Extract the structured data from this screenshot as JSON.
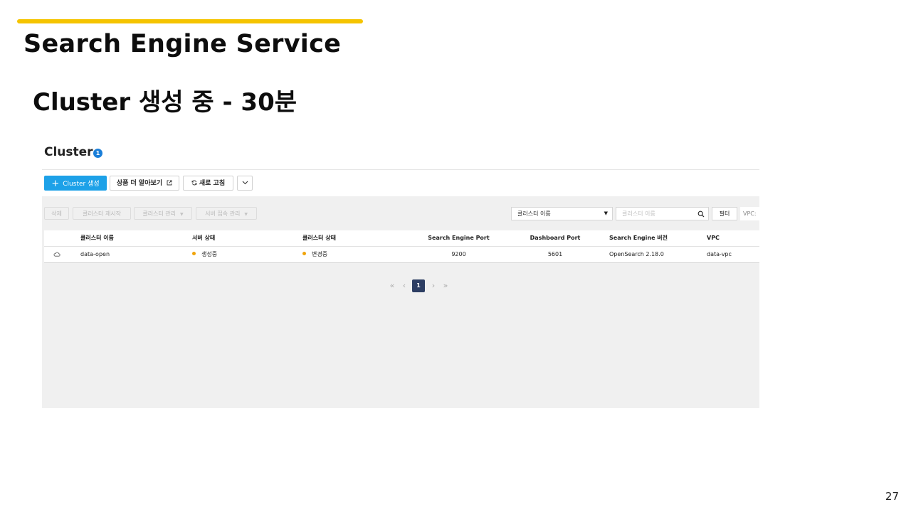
{
  "slide": {
    "title": "Search Engine Service",
    "subtitle": "Cluster 생성 중 - 30분",
    "page_number": "27",
    "accent_color": "#f5c400"
  },
  "console": {
    "header": {
      "title": "Cluster",
      "count": "1"
    },
    "actions": {
      "create_label": "Cluster 생성",
      "learn_more_label": "상품 더 알아보기",
      "refresh_label": "새로 고침"
    },
    "toolbar": {
      "delete_label": "삭제",
      "restart_label": "클러스터 재시작",
      "manage_label": "클러스터 관리",
      "access_label": "서버 접속 관리"
    },
    "filter": {
      "select_value": "클러스터 이름",
      "search_placeholder": "클러스터 이름",
      "filter_label": "필터",
      "vpc_label": "VPC:"
    },
    "table": {
      "columns": [
        "클러스터 이름",
        "서버 상태",
        "클러스터 상태",
        "Search Engine Port",
        "Dashboard Port",
        "Search Engine 버전",
        "VPC"
      ],
      "rows": [
        {
          "name": "data-open",
          "server_status": "생성중",
          "cluster_status": "변경중",
          "search_port": "9200",
          "dashboard_port": "5601",
          "version": "OpenSearch 2.18.0",
          "vpc": "data-vpc"
        }
      ]
    },
    "pagination": {
      "current_page": "1"
    },
    "colors": {
      "primary_button": "#1da1e8",
      "status_dot": "#f0a30a",
      "badge": "#1b7fd9",
      "current_page": "#2d3e63"
    }
  }
}
